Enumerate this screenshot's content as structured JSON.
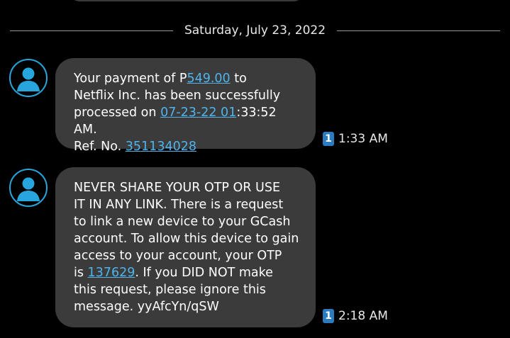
{
  "date_divider": "Saturday, July 23, 2022",
  "messages": [
    {
      "text_1": "Your payment of P",
      "link_amount": "549.00",
      "text_2": " to\nNetflix Inc. has been successfully\nprocessed on ",
      "link_datetime": "07-23-22 01",
      "text_3": ":33:52 AM.\nRef. No. ",
      "link_ref": "351134028",
      "sim": "1",
      "time": "1:33 AM"
    },
    {
      "text_1": "NEVER SHARE YOUR OTP OR USE\nIT IN ANY LINK. There is a request\nto link a new device to your GCash\naccount. To allow this device to gain\naccess to your account, your OTP\nis ",
      "link_otp": "137629",
      "text_2": ". If you DID NOT make\nthis request, please ignore this\nmessage. yyAfcYn/qSW",
      "sim": "1",
      "time": "2:18 AM"
    }
  ],
  "colors": {
    "background": "#000000",
    "bubble": "#3b3b3b",
    "link": "#4fb4ec",
    "avatar_accent": "#27a6dd",
    "sim_badge": "#2a7bc0"
  },
  "icons": {
    "avatar": "contact-avatar-icon",
    "sim": "sim-1-icon"
  }
}
